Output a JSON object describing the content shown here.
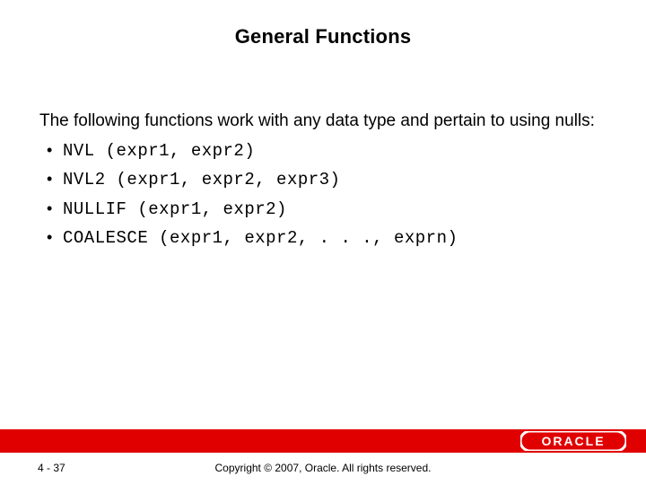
{
  "title": "General Functions",
  "intro": "The following functions work with any data type and pertain to using nulls:",
  "bullets": [
    "NVL (expr1, expr2)",
    "NVL2 (expr1, expr2, expr3)",
    "NULLIF (expr1, expr2)",
    "COALESCE (expr1, expr2, . . ., exprn)"
  ],
  "page_number": "4 - 37",
  "copyright": "Copyright © 2007, Oracle. All rights reserved.",
  "logo_text": "ORACLE"
}
